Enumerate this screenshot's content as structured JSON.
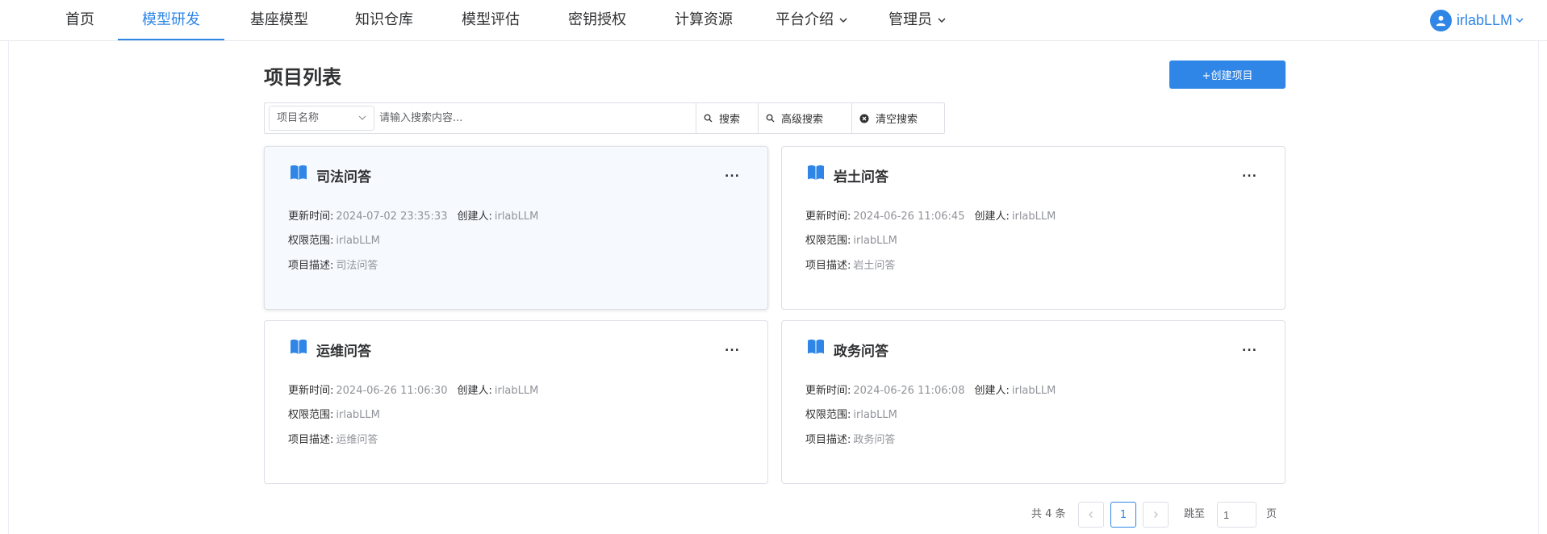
{
  "nav": {
    "items": [
      {
        "label": "首页"
      },
      {
        "label": "模型研发"
      },
      {
        "label": "基座模型"
      },
      {
        "label": "知识仓库"
      },
      {
        "label": "模型评估"
      },
      {
        "label": "密钥授权"
      },
      {
        "label": "计算资源"
      },
      {
        "label": "平台介绍"
      },
      {
        "label": "管理员"
      }
    ],
    "active_index": 1,
    "user_name": "irlabLLM"
  },
  "page": {
    "title": "项目列表",
    "create_button": "+创建项目"
  },
  "search": {
    "select_value": "项目名称",
    "placeholder": "请输入搜索内容...",
    "search_label": "搜索",
    "advanced_label": "高级搜索",
    "clear_label": "清空搜索"
  },
  "labels": {
    "updated": "更新时间:",
    "creator": "创建人:",
    "scope": "权限范围:",
    "desc": "项目描述:"
  },
  "projects": [
    {
      "title": "司法问答",
      "updated": "2024-07-02 23:35:33",
      "creator": "irlabLLM",
      "scope": "irlabLLM",
      "desc": "司法问答",
      "more": "..."
    },
    {
      "title": "岩土问答",
      "updated": "2024-06-26 11:06:45",
      "creator": "irlabLLM",
      "scope": "irlabLLM",
      "desc": "岩土问答",
      "more": "..."
    },
    {
      "title": "运维问答",
      "updated": "2024-06-26 11:06:30",
      "creator": "irlabLLM",
      "scope": "irlabLLM",
      "desc": "运维问答",
      "more": "..."
    },
    {
      "title": "政务问答",
      "updated": "2024-06-26 11:06:08",
      "creator": "irlabLLM",
      "scope": "irlabLLM",
      "desc": "政务问答",
      "more": "..."
    }
  ],
  "pagination": {
    "total": "共 4 条",
    "current_page": "1",
    "jump_label": "跳至",
    "jump_value": "1",
    "page_suffix": "页"
  },
  "colors": {
    "accent": "#2f86e6",
    "muted_text": "#909399",
    "border": "#dcdfe6"
  }
}
